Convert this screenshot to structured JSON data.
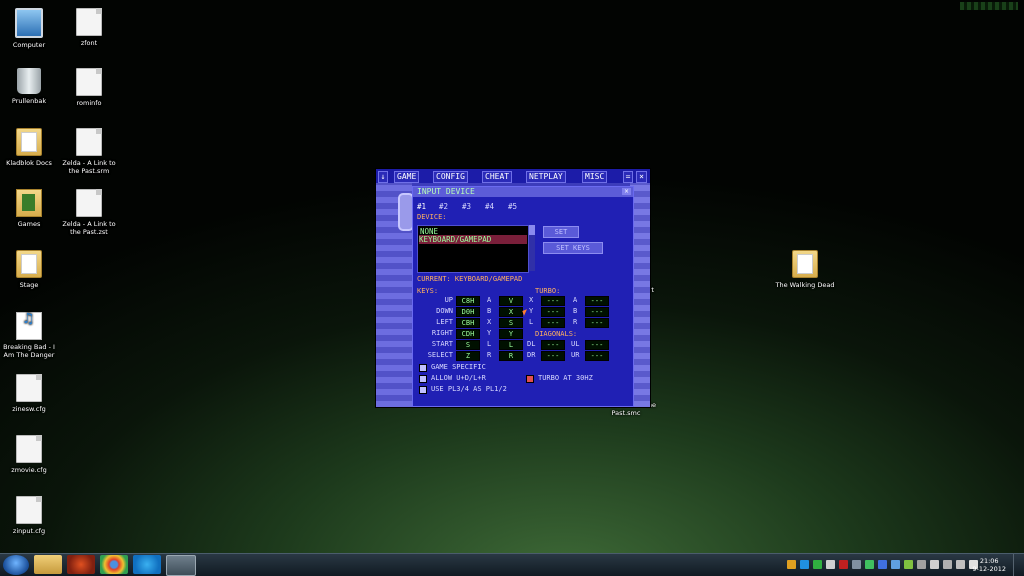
{
  "desktop": {
    "icons": [
      {
        "label": "Computer",
        "icon": "computer-icon"
      },
      {
        "label": "zfont",
        "icon": "file-icon"
      },
      {
        "label": "Prullenbak",
        "icon": "recycle-bin-icon"
      },
      {
        "label": "rominfo",
        "icon": "file-icon"
      },
      {
        "label": "Kladblok Docs",
        "icon": "folder-icon"
      },
      {
        "label": "Zelda - A Link to the Past.srm",
        "icon": "file-icon"
      },
      {
        "label": "Games",
        "icon": "games-folder-icon"
      },
      {
        "label": "Zelda - A Link to the Past.zst",
        "icon": "file-icon"
      },
      {
        "label": "Stage",
        "icon": "folder-icon"
      },
      {
        "label": "Breaking Bad - I Am The Danger",
        "icon": "mp3-icon"
      },
      {
        "label": "zinesw.cfg",
        "icon": "file-icon"
      },
      {
        "label": "zmovie.cfg",
        "icon": "file-icon"
      },
      {
        "label": "zinput.cfg",
        "icon": "file-icon"
      },
      {
        "label": "The Walking Dead",
        "icon": "folder-icon"
      }
    ],
    "partial_labels": [
      "rt",
      "he",
      "Past.smc"
    ]
  },
  "zsnes": {
    "menu": [
      "GAME",
      "CONFIG",
      "CHEAT",
      "NETPLAY",
      "MISC"
    ],
    "dialog_title": "INPUT DEVICE",
    "tabs": [
      "#1",
      "#2",
      "#3",
      "#4",
      "#5"
    ],
    "device_label": "DEVICE:",
    "devices": [
      "NONE",
      "KEYBOARD/GAMEPAD"
    ],
    "buttons": {
      "set": "SET",
      "set_keys": "SET KEYS"
    },
    "current": "CURRENT: KEYBOARD/GAMEPAD",
    "keys_label": "KEYS:",
    "turbo_label": "TURBO:",
    "diagonals_label": "DIAGONALS:",
    "keys": [
      {
        "name": "UP",
        "val": "C8H"
      },
      {
        "name": "DOWN",
        "val": "D0H"
      },
      {
        "name": "LEFT",
        "val": "CBH"
      },
      {
        "name": "RIGHT",
        "val": "CDH"
      },
      {
        "name": "START",
        "val": "S"
      },
      {
        "name": "SELECT",
        "val": "Z"
      }
    ],
    "buttons_map": [
      {
        "name": "A",
        "val": "V"
      },
      {
        "name": "B",
        "val": "X"
      },
      {
        "name": "X",
        "val": "S"
      },
      {
        "name": "Y",
        "val": "Y"
      },
      {
        "name": "L",
        "val": "L"
      },
      {
        "name": "R",
        "val": "R"
      }
    ],
    "turbo": [
      {
        "name": "X",
        "val": "---"
      },
      {
        "name": "Y",
        "val": "---"
      },
      {
        "name": "L",
        "val": "---"
      }
    ],
    "turbo2": [
      {
        "name": "A",
        "val": "---"
      },
      {
        "name": "B",
        "val": "---"
      },
      {
        "name": "R",
        "val": "---"
      }
    ],
    "diagonals": [
      {
        "name": "DL",
        "val": "---"
      },
      {
        "name": "DR",
        "val": "---"
      }
    ],
    "diagonals2": [
      {
        "name": "UL",
        "val": "---"
      },
      {
        "name": "UR",
        "val": "---"
      }
    ],
    "options": {
      "game_specific": "GAME SPECIFIC",
      "allow": "ALLOW U+D/L+R",
      "turbo60": "TURBO AT 30HZ",
      "use_pl": "USE PL3/4 AS PL1/2"
    }
  },
  "taskbar": {
    "time": "21:06",
    "date": "9-12-2012"
  }
}
